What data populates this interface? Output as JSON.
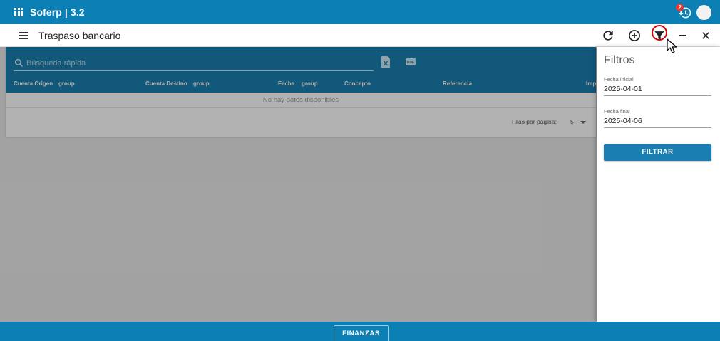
{
  "topbar": {
    "app_title": "Soferp | 3.2",
    "notification_count": "2",
    "accent_color": "#0c7fb5"
  },
  "appbar": {
    "title": "Traspaso bancario",
    "icons": [
      "refresh-icon",
      "add-circle-icon",
      "filter-icon",
      "minimize-icon",
      "close-icon"
    ]
  },
  "table": {
    "search_placeholder": "Búsqueda rápida",
    "export_icons": [
      "excel-icon",
      "pdf-icon"
    ],
    "pdf_label": "PDF",
    "columns": [
      {
        "label": "Cuenta Origen"
      },
      {
        "label": "group"
      },
      {
        "label": "Cuenta Destino"
      },
      {
        "label": "group"
      },
      {
        "label": "Fecha"
      },
      {
        "label": "group"
      },
      {
        "label": "Concepto"
      },
      {
        "label": "Referencia"
      },
      {
        "label": "Impo"
      }
    ],
    "empty_text": "No hay datos disponibles",
    "rows_per_page_label": "Filas por página:",
    "rows_per_page_value": "5"
  },
  "filters": {
    "title": "Filtros",
    "start_label": "Fecha inicial",
    "start_value": "2025-04-01",
    "end_label": "Fecha final",
    "end_value": "2025-04-06",
    "button_label": "FILTRAR"
  },
  "bottombar": {
    "module_label": "FINANZAS"
  }
}
